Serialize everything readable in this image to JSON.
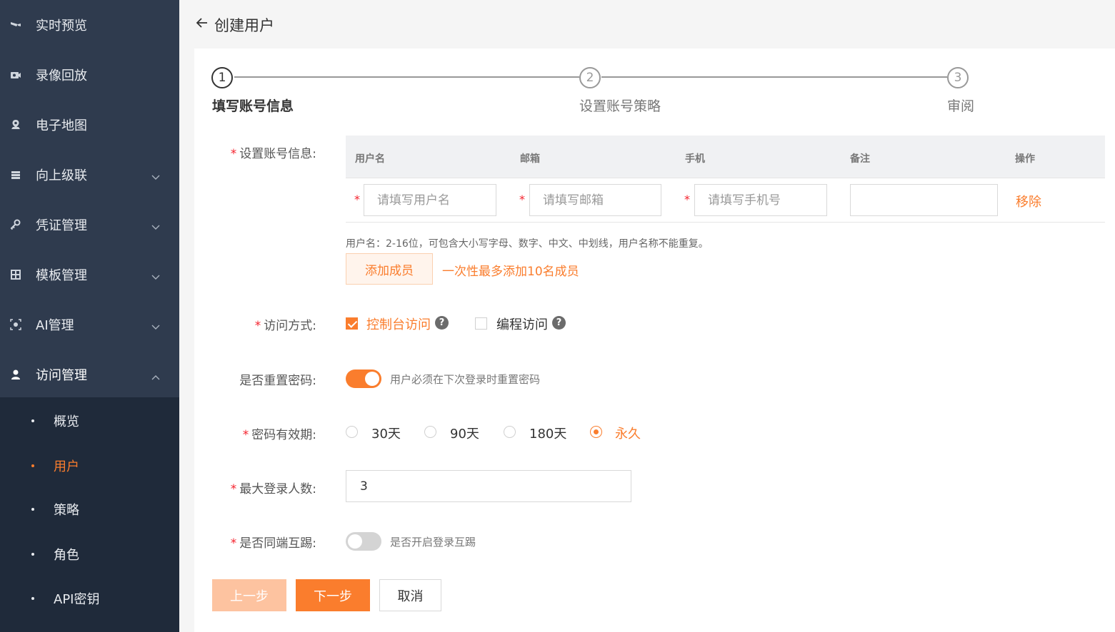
{
  "sidebar": {
    "items": [
      {
        "label": "实时预览",
        "icon": "video-camera-icon",
        "has_submenu": false
      },
      {
        "label": "录像回放",
        "icon": "playback-icon",
        "has_submenu": false
      },
      {
        "label": "电子地图",
        "icon": "map-pin-icon",
        "has_submenu": false
      },
      {
        "label": "向上级联",
        "icon": "server-stack-icon",
        "has_submenu": true
      },
      {
        "label": "凭证管理",
        "icon": "key-icon",
        "has_submenu": true
      },
      {
        "label": "模板管理",
        "icon": "grid-icon",
        "has_submenu": true
      },
      {
        "label": "AI管理",
        "icon": "ai-scan-icon",
        "has_submenu": true
      },
      {
        "label": "访问管理",
        "icon": "user-icon",
        "has_submenu": true,
        "expanded": true
      }
    ],
    "submenu": [
      {
        "label": "概览",
        "active": false
      },
      {
        "label": "用户",
        "active": true
      },
      {
        "label": "策略",
        "active": false
      },
      {
        "label": "角色",
        "active": false
      },
      {
        "label": "API密钥",
        "active": false
      }
    ]
  },
  "header": {
    "title": "创建用户"
  },
  "steps": [
    {
      "number": "1",
      "title": "填写账号信息",
      "active": true
    },
    {
      "number": "2",
      "title": "设置账号策略",
      "active": false
    },
    {
      "number": "3",
      "title": "审阅",
      "active": false
    }
  ],
  "form": {
    "account_info": {
      "label": "设置账号信息:",
      "columns": [
        "用户名",
        "邮箱",
        "手机",
        "备注",
        "操作"
      ],
      "row": {
        "username_placeholder": "请填写用户名",
        "email_placeholder": "请填写邮箱",
        "phone_placeholder": "请填写手机号",
        "remark_value": "",
        "remove_label": "移除"
      },
      "hint": "用户名：2-16位，可包含大小写字母、数字、中文、中划线，用户名称不能重复。",
      "add_button": "添加成员",
      "add_hint": "一次性最多添加10名成员"
    },
    "access_method": {
      "label": "访问方式:",
      "options": [
        {
          "label": "控制台访问",
          "checked": true
        },
        {
          "label": "编程访问",
          "checked": false
        }
      ]
    },
    "reset_password": {
      "label": "是否重置密码:",
      "on": true,
      "description": "用户必须在下次登录时重置密码"
    },
    "password_validity": {
      "label": "密码有效期:",
      "options": [
        {
          "label": "30天",
          "checked": false
        },
        {
          "label": "90天",
          "checked": false
        },
        {
          "label": "180天",
          "checked": false
        },
        {
          "label": "永久",
          "checked": true
        }
      ]
    },
    "max_login": {
      "label": "最大登录人数:",
      "value": "3"
    },
    "kick_same_end": {
      "label": "是否同端互踢:",
      "on": false,
      "description": "是否开启登录互踢"
    }
  },
  "buttons": {
    "prev": "上一步",
    "next": "下一步",
    "cancel": "取消"
  },
  "colors": {
    "accent": "#fa7d2d",
    "sidebar_bg": "#2f3b4e",
    "submenu_bg": "#1f2a3a",
    "required": "#f5222d"
  }
}
